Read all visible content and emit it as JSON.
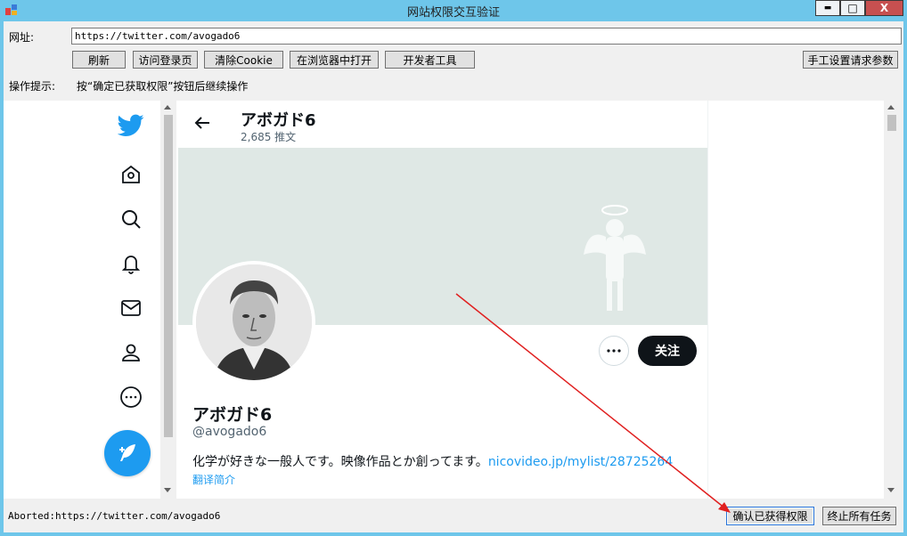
{
  "window": {
    "title": "网站权限交互验证",
    "minimize_glyph": "▬",
    "maximize_glyph": "□",
    "close_glyph": "X"
  },
  "address": {
    "label": "网址:",
    "value": "https://twitter.com/avogado6"
  },
  "toolbar": {
    "refresh": "刷新",
    "visit_login": "访问登录页",
    "clear_cookie": "清除Cookie",
    "open_in_browser": "在浏览器中打开",
    "devtools": "开发者工具",
    "manual_request": "手工设置请求参数"
  },
  "hint": {
    "label": "操作提示:",
    "text": "按“确定已获取权限”按钮后继续操作"
  },
  "profile": {
    "header_name": "アボガド6",
    "header_count": "2,685 推文",
    "name": "アボガド6",
    "handle": "@avogado6",
    "bio_text": "化学が好きな一般人です。映像作品とか創ってます。",
    "bio_link": "nicovideo.jp/mylist/28725264",
    "translate": "翻译简介",
    "follow": "关注"
  },
  "nav_icons": [
    "twitter-logo-icon",
    "explore-icon",
    "search-icon",
    "bell-icon",
    "mail-icon",
    "profile-icon",
    "more-icon"
  ],
  "status": {
    "text": "Aborted:https://twitter.com/avogado6"
  },
  "footer": {
    "confirm": "确认已获得权限",
    "stop_all": "终止所有任务"
  },
  "colors": {
    "titlebar": "#6ec6ea",
    "twitter_blue": "#1d9bf0",
    "follow_bg": "#0f1419",
    "banner_bg": "#dfe8e5",
    "arrow": "#e02020"
  }
}
